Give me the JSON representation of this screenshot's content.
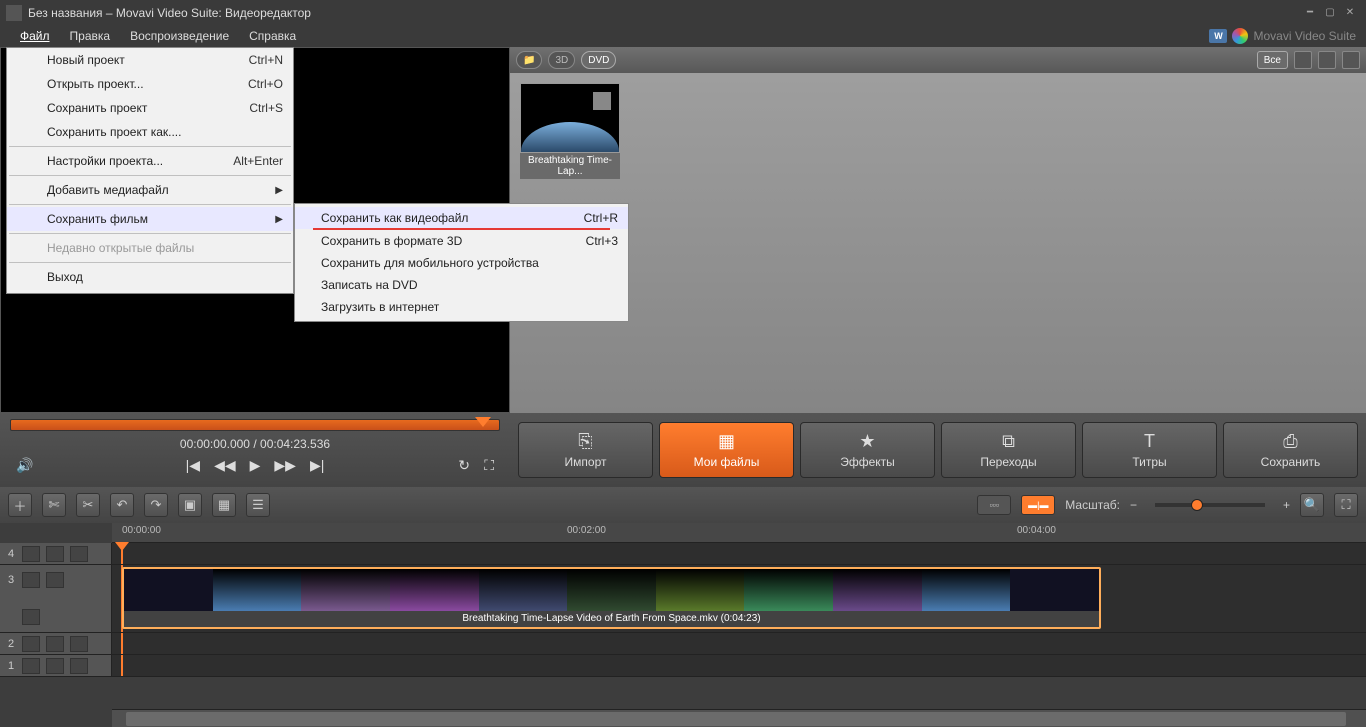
{
  "window": {
    "title": "Без названия – Movavi Video Suite: Видеоредактор"
  },
  "brand": {
    "text": "Movavi Video Suite"
  },
  "menubar": {
    "items": [
      "Файл",
      "Правка",
      "Воспроизведение",
      "Справка"
    ],
    "active_index": 0
  },
  "file_menu": {
    "new_project": {
      "label": "Новый проект",
      "shortcut": "Ctrl+N"
    },
    "open_project": {
      "label": "Открыть проект...",
      "shortcut": "Ctrl+O"
    },
    "save_project": {
      "label": "Сохранить проект",
      "shortcut": "Ctrl+S"
    },
    "save_project_as": {
      "label": "Сохранить проект как....",
      "shortcut": ""
    },
    "project_settings": {
      "label": "Настройки проекта...",
      "shortcut": "Alt+Enter"
    },
    "add_media": {
      "label": "Добавить медиафайл",
      "shortcut": ""
    },
    "save_movie": {
      "label": "Сохранить фильм",
      "shortcut": ""
    },
    "recent": {
      "label": "Недавно открытые файлы",
      "shortcut": ""
    },
    "exit": {
      "label": "Выход",
      "shortcut": ""
    }
  },
  "save_submenu": {
    "as_video": {
      "label": "Сохранить как видеофайл",
      "shortcut": "Ctrl+R"
    },
    "as_3d": {
      "label": "Сохранить в формате 3D",
      "shortcut": "Ctrl+3"
    },
    "for_mobile": {
      "label": "Сохранить для мобильного устройства",
      "shortcut": ""
    },
    "to_dvd": {
      "label": "Записать на DVD",
      "shortcut": ""
    },
    "to_web": {
      "label": "Загрузить в интернет",
      "shortcut": ""
    }
  },
  "library": {
    "tb": {
      "folder": "📁",
      "threeD": "3D",
      "dvd": "DVD",
      "all": "Все"
    },
    "item_name": "Breathtaking Time-Lap..."
  },
  "playback": {
    "current": "00:00:00.000",
    "sep": "/",
    "total": "00:04:23.536"
  },
  "main_buttons": {
    "import": "Импорт",
    "my_files": "Мои файлы",
    "effects": "Эффекты",
    "transitions": "Переходы",
    "titles": "Титры",
    "save": "Сохранить"
  },
  "zoom_label": "Масштаб:",
  "ruler": {
    "t0": "00:00:00",
    "t1": "00:02:00",
    "t2": "00:04:00"
  },
  "tracks": {
    "n4": "4",
    "n3": "3",
    "n2": "2",
    "n1": "1"
  },
  "clip": {
    "label": "Breathtaking Time-Lapse Video of Earth From Space.mkv (0:04:23)"
  }
}
